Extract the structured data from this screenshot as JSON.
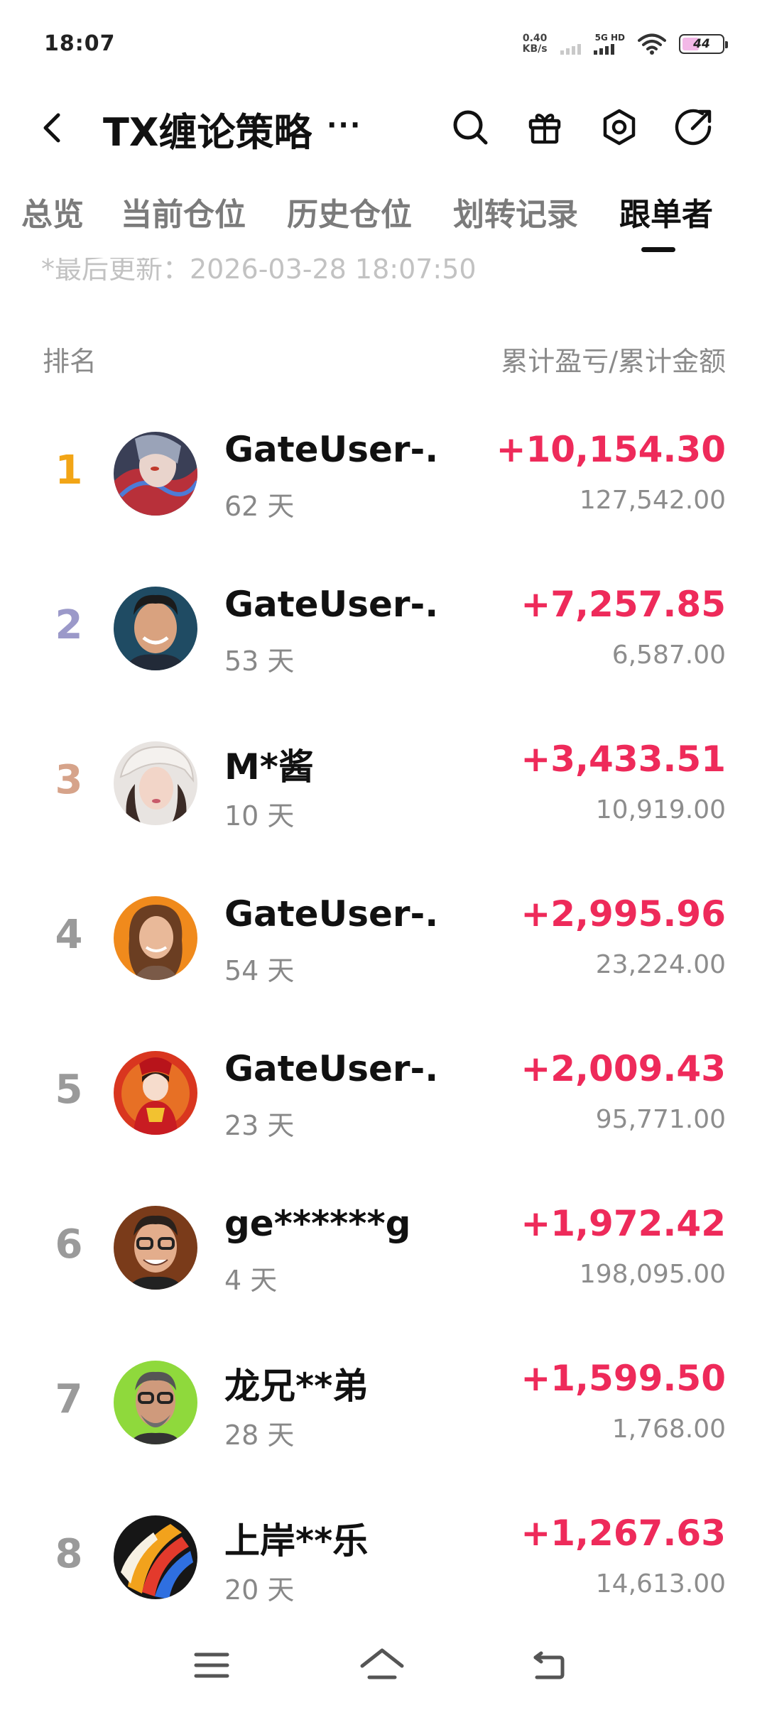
{
  "status": {
    "time": "18:07",
    "net_speed_value": "0.40",
    "net_speed_unit": "KB/s",
    "network_label": "5G HD",
    "battery": "44",
    "battery_level": 0.44
  },
  "header": {
    "title": "TX缠论策略",
    "title_more": "···",
    "icons": [
      "back-arrow-icon",
      "search-icon",
      "gift-icon",
      "settings-hexagon-icon",
      "share-icon"
    ]
  },
  "tabs": [
    {
      "label": "总览",
      "active": false
    },
    {
      "label": "当前仓位",
      "active": false
    },
    {
      "label": "历史仓位",
      "active": false
    },
    {
      "label": "划转记录",
      "active": false
    },
    {
      "label": "跟单者",
      "active": true
    }
  ],
  "last_updated": "*最后更新：2026-03-28 18:07:50",
  "table": {
    "rank_header": "排名",
    "value_header": "累计盈亏/累计金额",
    "rows": [
      {
        "rank": "1",
        "rank_color": "#f2a516",
        "name": "GateUser-...",
        "days": "62 天",
        "pnl": "+10,154.30",
        "amount": "127,542.00"
      },
      {
        "rank": "2",
        "rank_color": "#9b99c9",
        "name": "GateUser-...",
        "days": "53 天",
        "pnl": "+7,257.85",
        "amount": "6,587.00"
      },
      {
        "rank": "3",
        "rank_color": "#d6a38a",
        "name": "M*酱",
        "days": "10 天",
        "pnl": "+3,433.51",
        "amount": "10,919.00"
      },
      {
        "rank": "4",
        "rank_color": "#9a9a9a",
        "name": "GateUser-...",
        "days": "54 天",
        "pnl": "+2,995.96",
        "amount": "23,224.00"
      },
      {
        "rank": "5",
        "rank_color": "#9a9a9a",
        "name": "GateUser-...",
        "days": "23 天",
        "pnl": "+2,009.43",
        "amount": "95,771.00"
      },
      {
        "rank": "6",
        "rank_color": "#9a9a9a",
        "name": "ge******g",
        "days": "4 天",
        "pnl": "+1,972.42",
        "amount": "198,095.00"
      },
      {
        "rank": "7",
        "rank_color": "#9a9a9a",
        "name": "龙兄**弟",
        "days": "28 天",
        "pnl": "+1,599.50",
        "amount": "1,768.00"
      },
      {
        "rank": "8",
        "rank_color": "#9a9a9a",
        "name": "上岸**乐",
        "days": "20 天",
        "pnl": "+1,267.63",
        "amount": "14,613.00"
      }
    ]
  },
  "colors": {
    "profit": "#ee2a5a",
    "text_primary": "#111111",
    "text_secondary": "#888888"
  },
  "navbar": {
    "icons": [
      "menu-icon",
      "home-icon",
      "back-icon"
    ]
  }
}
